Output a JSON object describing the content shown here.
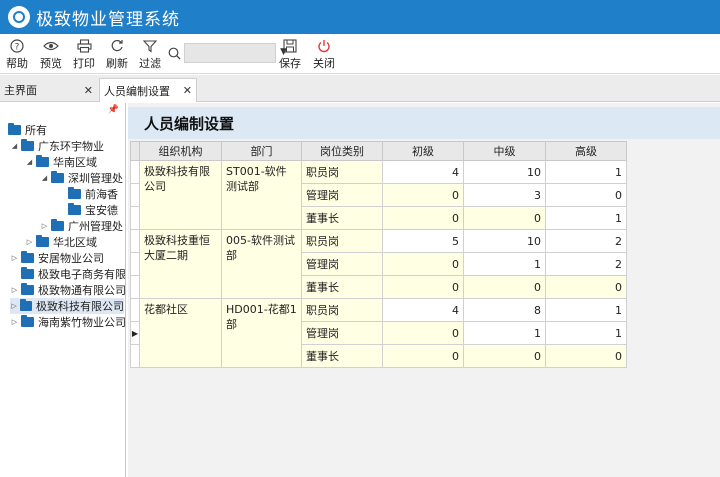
{
  "app": {
    "title": "极致物业管理系统"
  },
  "toolbar": {
    "help": "帮助",
    "preview": "预览",
    "print": "打印",
    "refresh": "刷新",
    "filter": "过滤",
    "search_value": "",
    "save": "保存",
    "close": "关闭"
  },
  "tabs": [
    {
      "label": "主界面"
    },
    {
      "label": "人员编制设置"
    }
  ],
  "tree": [
    {
      "label": "所有"
    },
    {
      "label": "广东环宇物业"
    },
    {
      "label": "华南区域"
    },
    {
      "label": "深圳管理处"
    },
    {
      "label": "前海香"
    },
    {
      "label": "宝安德"
    },
    {
      "label": "广州管理处"
    },
    {
      "label": "华北区域"
    },
    {
      "label": "安居物业公司"
    },
    {
      "label": "极致电子商务有限"
    },
    {
      "label": "极致物通有限公司"
    },
    {
      "label": "极致科技有限公司"
    },
    {
      "label": "海南紫竹物业公司"
    }
  ],
  "page": {
    "title": "人员编制设置"
  },
  "grid": {
    "headers": {
      "org": "组织机构",
      "dept": "部门",
      "post": "岗位类别",
      "junior": "初级",
      "middle": "中级",
      "senior": "高级"
    },
    "groups": [
      {
        "org": "极致科技有限公司",
        "dept": "ST001-软件测试部",
        "rows": [
          {
            "post": "职员岗",
            "junior": "4",
            "middle": "10",
            "senior": "1"
          },
          {
            "post": "管理岗",
            "junior": "0",
            "middle": "3",
            "senior": "0"
          },
          {
            "post": "董事长",
            "junior": "0",
            "middle": "0",
            "senior": "1"
          }
        ]
      },
      {
        "org": "极致科技重恒大厦二期",
        "dept": "005-软件测试部",
        "rows": [
          {
            "post": "职员岗",
            "junior": "5",
            "middle": "10",
            "senior": "2"
          },
          {
            "post": "管理岗",
            "junior": "0",
            "middle": "1",
            "senior": "2"
          },
          {
            "post": "董事长",
            "junior": "0",
            "middle": "0",
            "senior": "0"
          }
        ]
      },
      {
        "org": "花都社区",
        "dept": "HD001-花都1部",
        "rows": [
          {
            "post": "职员岗",
            "junior": "4",
            "middle": "8",
            "senior": "1"
          },
          {
            "post": "管理岗",
            "junior": "0",
            "middle": "1",
            "senior": "1"
          },
          {
            "post": "董事长",
            "junior": "0",
            "middle": "0",
            "senior": "0"
          }
        ]
      }
    ]
  }
}
